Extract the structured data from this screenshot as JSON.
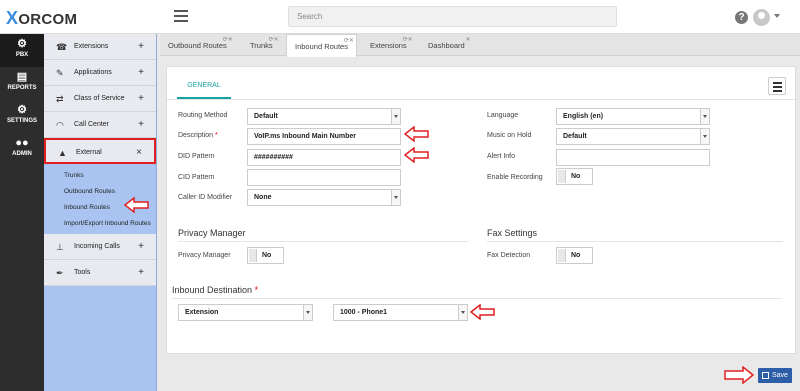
{
  "topbar": {
    "logo_mark": "X",
    "logo_text": "ORCOM",
    "search_placeholder": "Search",
    "help_label": "?"
  },
  "leftnav": [
    {
      "label": "PBX",
      "icon": "gear-icon"
    },
    {
      "label": "REPORTS",
      "icon": "report-icon"
    },
    {
      "label": "SETTINGS",
      "icon": "settings-icon"
    },
    {
      "label": "ADMIN",
      "icon": "users-icon"
    }
  ],
  "subnav": {
    "items": [
      {
        "label": "Extensions",
        "icon": "phone-icon",
        "ctl": "+"
      },
      {
        "label": "Applications",
        "icon": "edit-icon",
        "ctl": "+"
      },
      {
        "label": "Class of Service",
        "icon": "shuffle-icon",
        "ctl": "+"
      },
      {
        "label": "Call Center",
        "icon": "headset-icon",
        "ctl": "+"
      },
      {
        "label": "External",
        "icon": "road-icon",
        "ctl": "×"
      }
    ],
    "subitems": [
      "Trunks",
      "Outbound Routes",
      "Inbound Routes",
      "Import/Export Inbound Routes"
    ],
    "bottom_items": [
      {
        "label": "Incoming Calls",
        "icon": "tree-icon",
        "ctl": "+"
      },
      {
        "label": "Tools",
        "icon": "wrench-icon",
        "ctl": "+"
      }
    ]
  },
  "tabs": [
    "Outbound Routes",
    "Trunks",
    "Inbound Routes",
    "Extensions",
    "Dashboard"
  ],
  "form": {
    "general_tab": "GENERAL",
    "routing_method_label": "Routing Method",
    "routing_method_value": "Default",
    "description_label": "Description",
    "description_value": "VoIP.ms Inbound Main Number",
    "did_pattern_label": "DID Pattern",
    "did_pattern_value": "##########",
    "cid_pattern_label": "CID Pattern",
    "cid_pattern_value": "",
    "caller_id_modifier_label": "Caller ID Modifier",
    "caller_id_modifier_value": "None",
    "language_label": "Language",
    "language_value": "English (en)",
    "music_on_hold_label": "Music on Hold",
    "music_on_hold_value": "Default",
    "alert_info_label": "Alert Info",
    "alert_info_value": "",
    "enable_recording_label": "Enable Recording",
    "enable_recording_value": "No",
    "privacy_section": "Privacy Manager",
    "privacy_manager_label": "Privacy Manager",
    "privacy_manager_value": "No",
    "fax_section": "Fax Settings",
    "fax_detection_label": "Fax Detection",
    "fax_detection_value": "No",
    "inbound_destination_label": "Inbound Destination",
    "destination_type_value": "Extension",
    "destination_value": "1000 - Phone1",
    "required_mark": "*"
  },
  "save_label": "Save",
  "colors": {
    "accent": "#1aa3a3",
    "subnav_bg": "#a9c4f0",
    "highlight": "#e02020",
    "save": "#2e5ea8"
  }
}
